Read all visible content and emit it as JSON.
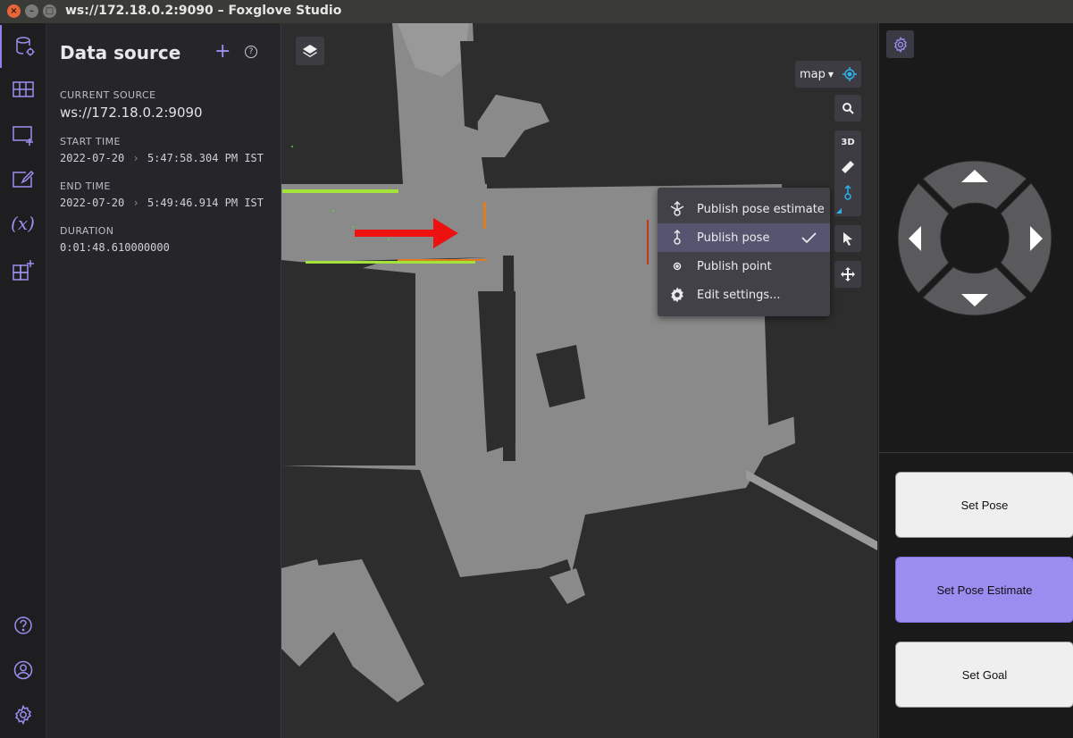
{
  "window": {
    "title": "ws://172.18.0.2:9090 – Foxglove Studio"
  },
  "activity_bar": {
    "items": [
      "data-source-icon",
      "layouts-icon",
      "add-panel-icon",
      "edit-panel-icon",
      "variables-icon",
      "extensions-icon"
    ],
    "variables_glyph": "(x)",
    "bottom": [
      "help-icon",
      "account-icon",
      "settings-icon"
    ]
  },
  "data_source": {
    "title": "Data source",
    "current_source_label": "CURRENT SOURCE",
    "current_source": "ws://172.18.0.2:9090",
    "start_time_label": "START TIME",
    "start_date": "2022-07-20",
    "start_time": "5:47:58.304 PM IST",
    "end_time_label": "END TIME",
    "end_date": "2022-07-20",
    "end_time": "5:49:46.914 PM IST",
    "duration_label": "DURATION",
    "duration": "0:01:48.610000000"
  },
  "viewport": {
    "frame_label": "map",
    "toggle_3d": "3D",
    "publish_menu": [
      {
        "label": "Publish pose estimate",
        "icon": "pose-estimate-icon",
        "selected": false
      },
      {
        "label": "Publish pose",
        "icon": "pose-icon",
        "selected": true
      },
      {
        "label": "Publish point",
        "icon": "point-icon",
        "selected": false
      },
      {
        "label": "Edit settings...",
        "icon": "gear-icon",
        "selected": false
      }
    ],
    "accent_color": "#2fb0e8"
  },
  "teleop": {
    "buttons": [
      "Set Pose",
      "Set Pose Estimate",
      "Set Goal"
    ],
    "active_button": "Set Pose Estimate",
    "active_color": "#9b8cf0"
  }
}
